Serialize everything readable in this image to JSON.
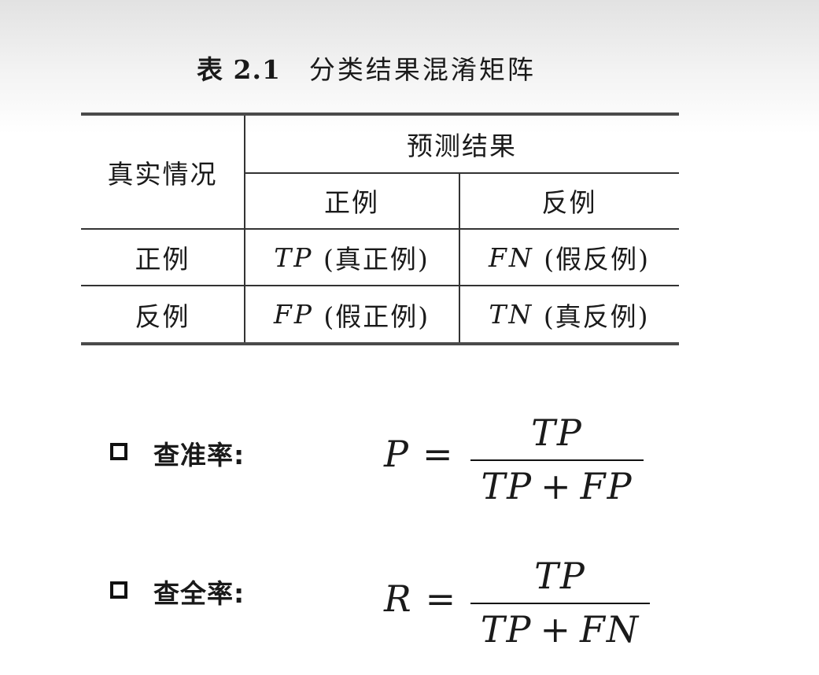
{
  "caption": {
    "label": "表 2.1",
    "text": "分类结果混淆矩阵"
  },
  "table": {
    "header_actual": "真实情况",
    "header_predicted": "预测结果",
    "pred_positive": "正例",
    "pred_negative": "反例",
    "rows": [
      {
        "actual": "正例",
        "c1_abbr": "TP",
        "c1_name": "(真正例)",
        "c2_abbr": "FN",
        "c2_name": "(假反例)"
      },
      {
        "actual": "反例",
        "c1_abbr": "FP",
        "c1_name": "(假正例)",
        "c2_abbr": "TN",
        "c2_name": "(真反例)"
      }
    ]
  },
  "precision": {
    "label": "查准率:",
    "symbol": "P",
    "equals": "=",
    "numerator": "TP",
    "den_a": "TP",
    "plus": "+",
    "den_b": "FP"
  },
  "recall": {
    "label": "查全率:",
    "symbol": "R",
    "equals": "=",
    "numerator": "TP",
    "den_a": "TP",
    "plus": "+",
    "den_b": "FN"
  }
}
